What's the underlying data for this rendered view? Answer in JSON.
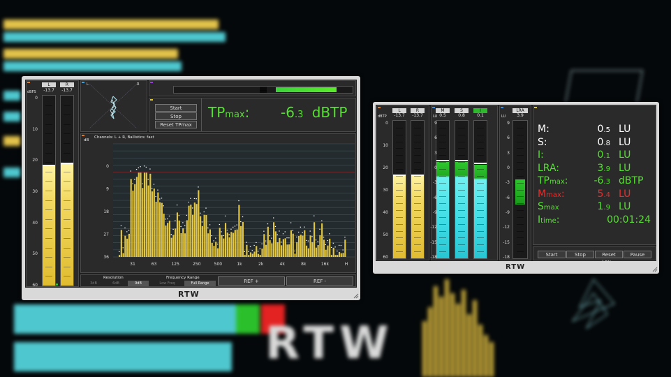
{
  "brand": "RTW",
  "left_panel": {
    "channels": [
      {
        "name": "L",
        "peak": "-13.7"
      },
      {
        "name": "R",
        "peak": "-13.7"
      }
    ],
    "scale_unit": "dBFS",
    "scale": [
      "0",
      "10",
      "20",
      "30",
      "40",
      "50",
      "60"
    ],
    "meter_levels": [
      0.63,
      0.64
    ],
    "vector_labels": {
      "l": "L",
      "r": "R"
    },
    "correlation_level": 0.34,
    "buttons": {
      "start": "Start",
      "stop": "Stop",
      "reset": "Reset TPmax"
    },
    "tpmax": {
      "label_main": "TP",
      "label_sub": "max",
      "label_colon": ":",
      "value_int": "-6",
      "value_dec": ".3",
      "unit": "dBTP"
    },
    "spectrum": {
      "header": "Channels: L + R, Ballistics: fast",
      "y_unit": "dB",
      "y_ticks": [
        "0",
        "9",
        "18",
        "27",
        "36"
      ],
      "x_ticks": [
        "31",
        "63",
        "125",
        "250",
        "500",
        "1k",
        "2k",
        "4k",
        "8k",
        "16k",
        "H"
      ]
    },
    "footer": {
      "resolution_label": "Resolution",
      "resolution_options": [
        "3dB",
        "6dB",
        "9dB"
      ],
      "resolution_selected": "9dB",
      "range_label": "Frequency Range",
      "range_options": [
        "Low Freq",
        "Full Range"
      ],
      "range_selected": "Full Range",
      "ref_plus": "REF +",
      "ref_minus": "REF -"
    }
  },
  "right_panel": {
    "channels": [
      {
        "name": "L",
        "peak": "-13.7"
      },
      {
        "name": "R",
        "peak": "-13.7"
      }
    ],
    "scale_unit": "dBTP",
    "scale": [
      "0",
      "10",
      "20",
      "30",
      "40",
      "50",
      "60"
    ],
    "meter_levels": [
      0.6,
      0.6
    ],
    "lu_unit": "LU",
    "loudness": [
      {
        "name": "M",
        "value": "0.5"
      },
      {
        "name": "S",
        "value": "0.8"
      },
      {
        "name": "I",
        "value": "0.1"
      }
    ],
    "lu_scale": [
      "9",
      "6",
      "3",
      "0",
      "-3",
      "-6",
      "-9",
      "-12",
      "-15",
      "-18"
    ],
    "loudness_levels": [
      0.7,
      0.7,
      0.68
    ],
    "lra": {
      "name": "LRA",
      "value": "3.9",
      "unit": "LU"
    },
    "lra_scale": [
      "9",
      "6",
      "3",
      "0",
      "-3",
      "-6",
      "-9",
      "-12",
      "-15",
      "-18"
    ],
    "readouts": [
      {
        "label": "M",
        "sub": "",
        "colon": ":",
        "int": "0",
        "dec": ".5",
        "unit": "LU",
        "color": "#ffffff"
      },
      {
        "label": "S",
        "sub": "",
        "colon": ":",
        "int": "0",
        "dec": ".8",
        "unit": "LU",
        "color": "#ffffff"
      },
      {
        "label": "I",
        "sub": "",
        "colon": ":",
        "int": "0",
        "dec": ".1",
        "unit": "LU",
        "color": "#55e030"
      },
      {
        "label": "LRA",
        "sub": "",
        "colon": ":",
        "int": "3",
        "dec": ".9",
        "unit": "LU",
        "color": "#55e030"
      },
      {
        "label": "TP",
        "sub": "max",
        "colon": ":",
        "int": "-6",
        "dec": ".3",
        "unit": "dBTP",
        "color": "#55e030"
      },
      {
        "label": "M",
        "sub": "max",
        "colon": ":",
        "int": "5",
        "dec": ".4",
        "unit": "LU",
        "color": "#ee2a2a"
      },
      {
        "label": "S",
        "sub": "max",
        "colon": "",
        "int": "1",
        "dec": ".9",
        "unit": "LU",
        "color": "#55e030"
      },
      {
        "label": "I",
        "sub": "time",
        "colon": ":",
        "int": "",
        "dec": "",
        "unit": "00:01:24",
        "color": "#55e030"
      }
    ],
    "buttons": {
      "start": "Start",
      "stop": "Stop",
      "reset": "Reset Lou...",
      "pause": "Pause"
    }
  }
}
